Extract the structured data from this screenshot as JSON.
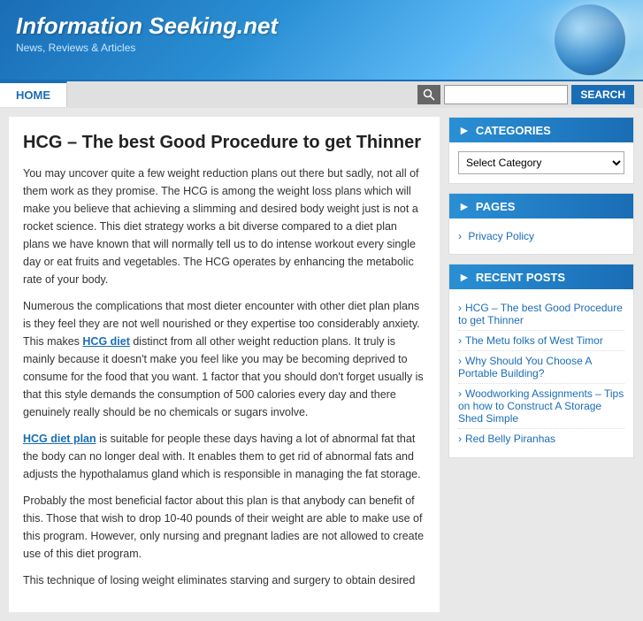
{
  "header": {
    "site_title": "Information Seeking.net",
    "site_subtitle": "News, Reviews & Articles"
  },
  "navbar": {
    "items": [
      {
        "label": "HOME"
      }
    ],
    "search_placeholder": "",
    "search_button_label": "SEARCH"
  },
  "main": {
    "article_title": "HCG – The best Good Procedure to get Thinner",
    "paragraphs": [
      "You may uncover quite a few weight reduction plans out there but sadly, not all of them work as they promise. The HCG is among the weight loss plans which will make you believe that achieving a slimming and desired body weight just is not a rocket science. This diet strategy works a bit diverse compared to a diet plan plans we have known that will normally tell us to do intense workout every single day or eat fruits and vegetables. The HCG operates by enhancing the metabolic rate of your body.",
      "Numerous the complications that most dieter encounter with other diet plan plans is they feel they are not well nourished or they expertise too considerably anxiety. This makes HCG diet distinct from all other weight reduction plans. It truly is mainly because it doesn't make you feel like you may be becoming deprived to consume for the food that you want. 1 factor that you should don't forget usually is that this style demands the consumption of 500 calories every day and there genuinely really should be no chemicals or sugars involve.",
      "HCG diet plan is suitable for people these days having a lot of abnormal fat that the body can no longer deal with. It enables them to get rid of abnormal fats and adjusts the hypothalamus gland which is responsible in managing the fat storage.",
      "Probably the most beneficial factor about this plan is that anybody can benefit of this. Those that wish to drop 10-40 pounds of their weight are able to make use of this program. However, only nursing and pregnant ladies are not allowed to create use of this diet program.",
      "This technique of losing weight eliminates starving and surgery to obtain desired"
    ],
    "hcg_link_text": "HCG diet",
    "hcg_plan_link_text": "HCG diet plan"
  },
  "sidebar": {
    "categories": {
      "header": "CATEGORIES",
      "select_label": "Select Category",
      "options": [
        "Select Category"
      ]
    },
    "pages": {
      "header": "PAGES",
      "items": [
        {
          "label": "Privacy Policy",
          "href": "#"
        }
      ]
    },
    "recent_posts": {
      "header": "RECENT POSTS",
      "items": [
        {
          "label": "HCG – The best Good Procedure to get Thinner",
          "href": "#"
        },
        {
          "label": "The Metu folks of West Timor",
          "href": "#"
        },
        {
          "label": "Why Should You Choose A Portable Building?",
          "href": "#"
        },
        {
          "label": "Woodworking Assignments – Tips on how to Construct A Storage Shed Simple",
          "href": "#"
        },
        {
          "label": "Red Belly Piranhas",
          "href": "#"
        }
      ]
    }
  }
}
